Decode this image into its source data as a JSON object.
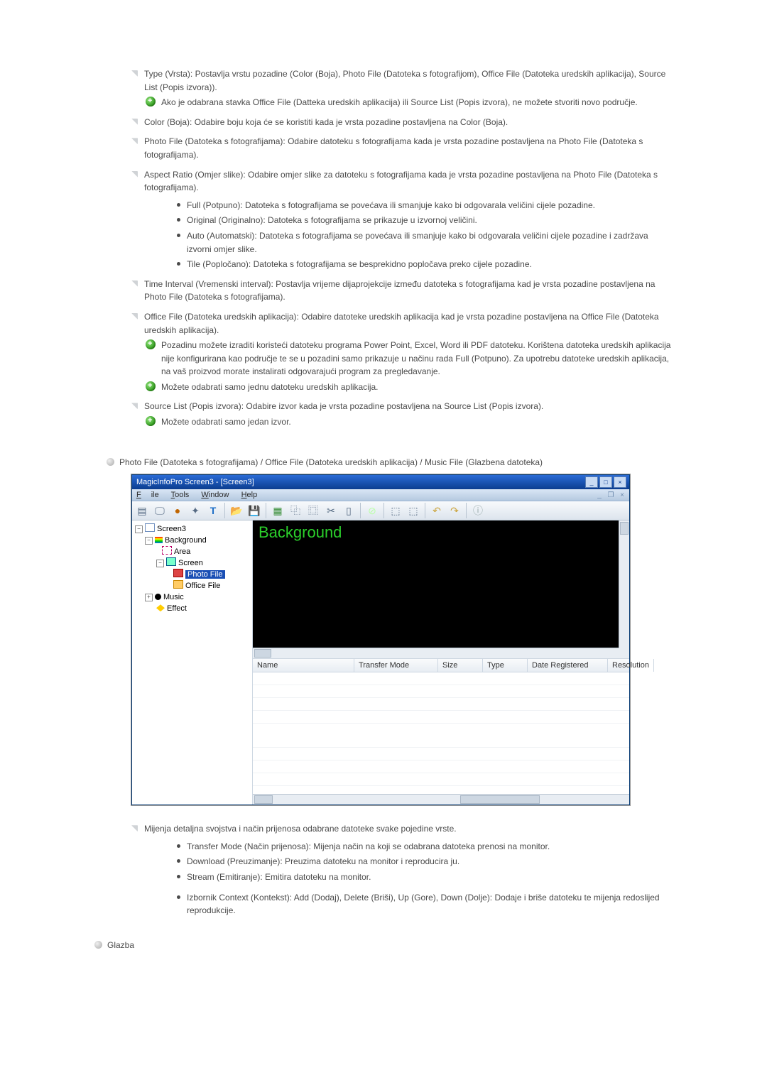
{
  "bullets": {
    "type": "Type (Vrsta): Postavlja vrstu pozadine (Color (Boja), Photo File (Datoteka s fotografijom), Office File (Datoteka uredskih aplikacija), Source List (Popis izvora)).",
    "type_note": "Ako je odabrana stavka Office File (Datteka uredskih aplikacija) ili Source List (Popis izvora), ne možete stvoriti novo područje.",
    "color": "Color (Boja): Odabire boju koja će se koristiti kada je vrsta pozadine postavljena na Color (Boja).",
    "photo": "Photo File (Datoteka s fotografijama): Odabire datoteku s fotografijama kada je vrsta pozadine postavljena na Photo File (Datoteka s fotografijama).",
    "aspect": "Aspect Ratio (Omjer slike): Odabire omjer slike za datoteku s fotografijama kada je vrsta pozadine postavljena na Photo File (Datoteka s fotografijama).",
    "aspect_items": [
      "Full (Potpuno): Datoteka s fotografijama se povećava ili smanjuje kako bi odgovarala veličini cijele pozadine.",
      "Original (Originalno): Datoteka s fotografijama se prikazuje u izvornoj veličini.",
      "Auto (Automatski): Datoteka s fotografijama se povećava ili smanjuje kako bi odgovarala veličini cijele pozadine i zadržava izvorni omjer slike.",
      "Tile (Popločano): Datoteka s fotografijama se besprekidno popločava preko cijele pozadine."
    ],
    "time": "Time Interval (Vremenski interval): Postavlja vrijeme dijaprojekcije između datoteka s fotografijama kad je vrsta pozadine postavljena na Photo File (Datoteka s fotografijama).",
    "office": "Office File (Datoteka uredskih aplikacija): Odabire datoteke uredskih aplikacija kad je vrsta pozadine postavljena na Office File (Datoteka uredskih aplikacija).",
    "office_note1": "Pozadinu možete izraditi koristeći datoteku programa Power Point, Excel, Word ili PDF datoteku. Korištena datoteka uredskih aplikacija nije konfigurirana kao područje te se u pozadini samo prikazuje u načinu rada Full (Potpuno). Za upotrebu datoteke uredskih aplikacija, na vaš proizvod morate instalirati odgovarajući program za pregledavanje.",
    "office_note2": "Možete odabrati samo jednu datoteku uredskih aplikacija.",
    "source": "Source List (Popis izvora): Odabire izvor kada je vrsta pozadine postavljena na Source List (Popis izvora).",
    "source_note": "Možete odabrati samo jedan izvor."
  },
  "section_heading": "Photo File (Datoteka s fotografijama) / Office File (Datoteka uredskih aplikacija) / Music File (Glazbena datoteka)",
  "app": {
    "title": "MagicInfoPro Screen3 - [Screen3]",
    "menus": {
      "file": "File",
      "tools": "Tools",
      "window": "Window",
      "help": "Help"
    },
    "tree": {
      "root": "Screen3",
      "background": "Background",
      "area": "Area",
      "screen": "Screen",
      "photo": "Photo File",
      "office": "Office File",
      "music": "Music",
      "effect": "Effect"
    },
    "preview_label": "Background",
    "columns": {
      "name": "Name",
      "tm": "Transfer Mode",
      "size": "Size",
      "type": "Type",
      "date": "Date Registered",
      "res": "Resolution"
    }
  },
  "post": {
    "changes": "Mijenja detaljna svojstva i način prijenosa odabrane datoteke svake pojedine vrste.",
    "items": [
      "Transfer Mode (Način prijenosa): Mijenja način na koji se odabrana datoteka prenosi na monitor.",
      "Download (Preuzimanje): Preuzima datoteku na monitor i reproducira ju.",
      "Stream (Emitiranje): Emitira datoteku na monitor."
    ],
    "context": "Izbornik Context (Kontekst): Add (Dodaj), Delete (Briši), Up (Gore), Down (Dolje): Dodaje i briše datoteku te mijenja redoslijed reprodukcije."
  },
  "glazba": "Glazba"
}
